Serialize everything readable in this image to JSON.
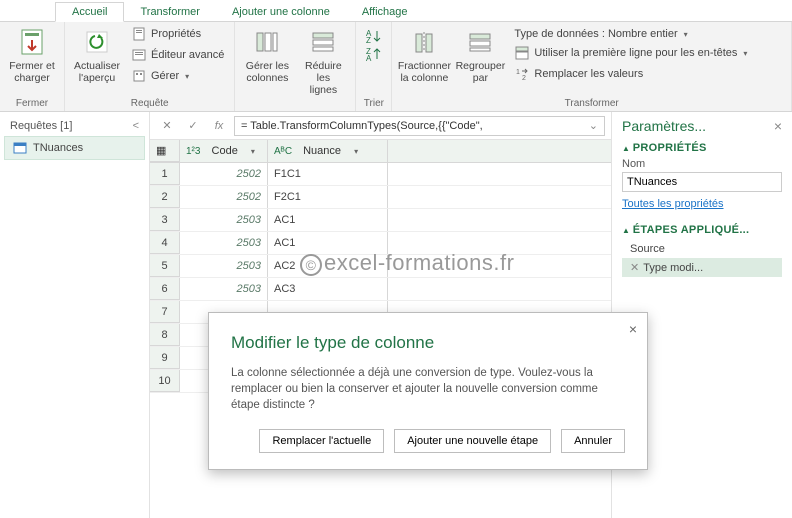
{
  "tabs": {
    "accueil": "Accueil",
    "transformer": "Transformer",
    "ajouter": "Ajouter une colonne",
    "affichage": "Affichage"
  },
  "ribbon": {
    "fermer": {
      "label": "Fermer et\ncharger",
      "group": "Fermer"
    },
    "requete": {
      "actualiser": "Actualiser\nl'aperçu",
      "proprietes": "Propriétés",
      "editeur": "Éditeur avancé",
      "gerer": "Gérer",
      "group": "Requête"
    },
    "colonnes": {
      "gerer": "Gérer les\ncolonnes",
      "reduire": "Réduire les\nlignes"
    },
    "trier": {
      "group": "Trier"
    },
    "transform": {
      "fractionner": "Fractionner\nla colonne",
      "regrouper": "Regrouper\npar",
      "type": "Type de données : Nombre entier",
      "premiere": "Utiliser la première ligne pour les en-têtes",
      "remplacer": "Remplacer les valeurs",
      "group": "Transformer"
    }
  },
  "queries": {
    "header": "Requêtes [1]",
    "item": "TNuances"
  },
  "formula": "= Table.TransformColumnTypes(Source,{{\"Code\",",
  "columns": {
    "code": "Code",
    "nuance": "Nuance"
  },
  "rows": [
    {
      "n": "1",
      "code": "2502",
      "nuance": "F1C1"
    },
    {
      "n": "2",
      "code": "2502",
      "nuance": "F2C1"
    },
    {
      "n": "3",
      "code": "2503",
      "nuance": "AC1"
    },
    {
      "n": "4",
      "code": "2503",
      "nuance": "AC1"
    },
    {
      "n": "5",
      "code": "2503",
      "nuance": "AC2"
    },
    {
      "n": "6",
      "code": "2503",
      "nuance": "AC3"
    },
    {
      "n": "7",
      "code": "",
      "nuance": ""
    },
    {
      "n": "8",
      "code": "",
      "nuance": ""
    },
    {
      "n": "9",
      "code": "",
      "nuance": ""
    },
    {
      "n": "10",
      "code": "",
      "nuance": ""
    }
  ],
  "settings": {
    "title": "Paramètres...",
    "prop_sect": "PROPRIÉTÉS",
    "nom_label": "Nom",
    "nom_value": "TNuances",
    "toutes": "Toutes les propriétés",
    "etapes_sect": "ÉTAPES APPLIQUÉ...",
    "step_source": "Source",
    "step_type": "Type modi..."
  },
  "dialog": {
    "title": "Modifier le type de colonne",
    "body": "La colonne sélectionnée a déjà une conversion de type. Voulez-vous la remplacer ou bien la conserver et ajouter la nouvelle conversion comme étape distincte ?",
    "btn_replace": "Remplacer l'actuelle",
    "btn_add": "Ajouter une nouvelle étape",
    "btn_cancel": "Annuler"
  },
  "watermark": "excel-formations.fr"
}
